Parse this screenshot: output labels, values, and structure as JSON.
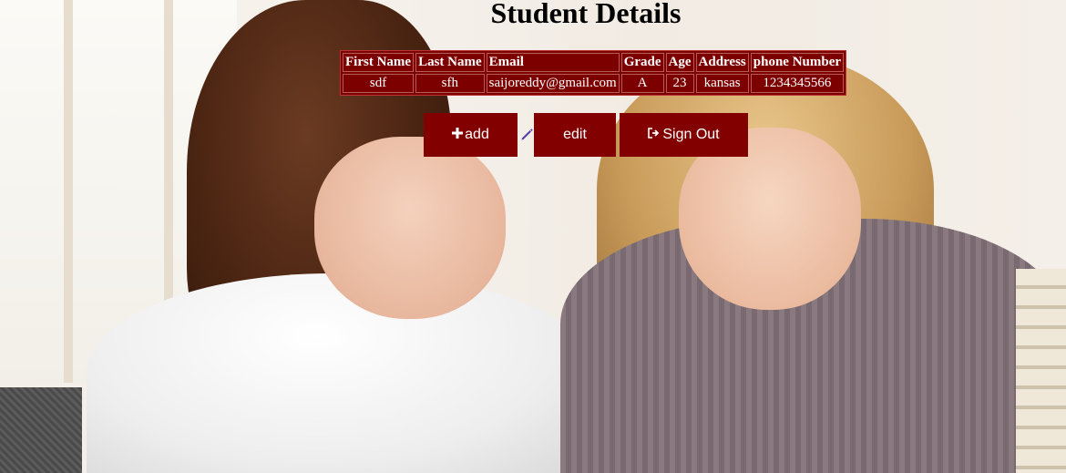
{
  "page": {
    "title": "Student Details"
  },
  "table": {
    "headers": [
      "First Name",
      "Last Name",
      "Email",
      "Grade",
      "Age",
      "Address",
      "phone Number"
    ],
    "rows": [
      [
        "sdf",
        "sfh",
        "saijoreddy@gmail.com",
        "A",
        "23",
        "kansas",
        "1234345566"
      ]
    ]
  },
  "buttons": {
    "add_label": "add",
    "add_icon": "plus-icon",
    "edit_label": "edit",
    "edit_icon": "pencil-icon",
    "signout_label": "Sign Out",
    "signout_icon": "logout-icon"
  },
  "colors": {
    "accent": "#820000",
    "pencil": "#5b3fa8",
    "text_on_accent": "#ffffff"
  }
}
